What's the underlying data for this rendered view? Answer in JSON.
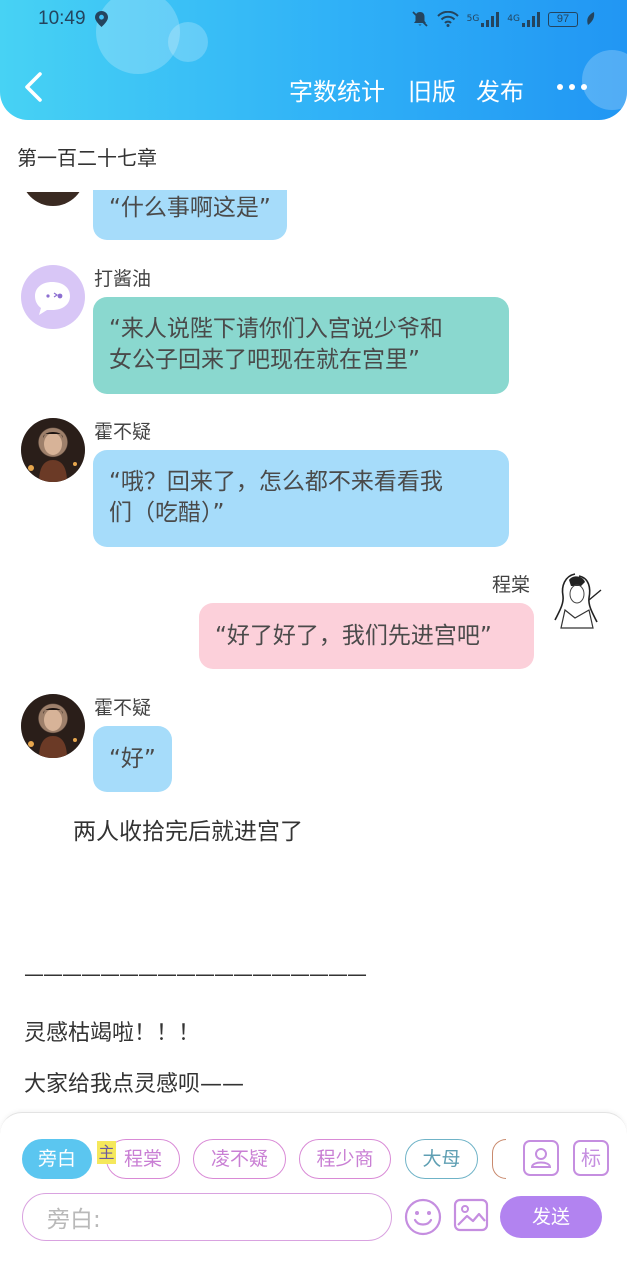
{
  "status_bar": {
    "time": "10:49",
    "network_5g": "5G",
    "network_4g": "4G",
    "battery": "97"
  },
  "toolbar": {
    "word_count": "字数统计",
    "old_version": "旧版",
    "publish": "发布"
  },
  "chapter_title": "第一百二十七章",
  "messages": [
    {
      "speaker": "",
      "text": "“什么事啊这是”"
    },
    {
      "speaker": "打酱油",
      "text_lines": [
        "“来人说陛下请你们入宫说少爷和",
        "女公子回来了吧现在就在宫里”"
      ]
    },
    {
      "speaker": "霍不疑",
      "text_lines": [
        "“哦？回来了，怎么都不来看看我",
        "们（吃醋）”"
      ]
    },
    {
      "speaker": "程棠",
      "text": "“好了好了，我们先进宫吧”"
    },
    {
      "speaker": "霍不疑",
      "text": "“好”"
    }
  ],
  "narration": "两人收拾完后就进宫了",
  "author_note": {
    "divider": "——————————————————",
    "line1": "灵感枯竭啦！！！",
    "line2": "大家给我点灵感呗——"
  },
  "composer": {
    "role_chips": [
      "旁白",
      "程棠",
      "凌不疑",
      "程少商",
      "大母"
    ],
    "main_tag": "主",
    "tag_button": "标",
    "input_value": "旁白:",
    "send": "发送"
  },
  "colors": {
    "header_start": "#47d2f4",
    "header_end": "#2196f3",
    "send_button": "#b283f0",
    "active_chip": "#5bc6f0"
  },
  "icons": [
    "location-icon",
    "mute-icon",
    "wifi-icon",
    "signal-icon",
    "battery-icon",
    "back-arrow-icon",
    "more-dots-icon",
    "contact-icon",
    "emoji-icon",
    "image-icon"
  ]
}
